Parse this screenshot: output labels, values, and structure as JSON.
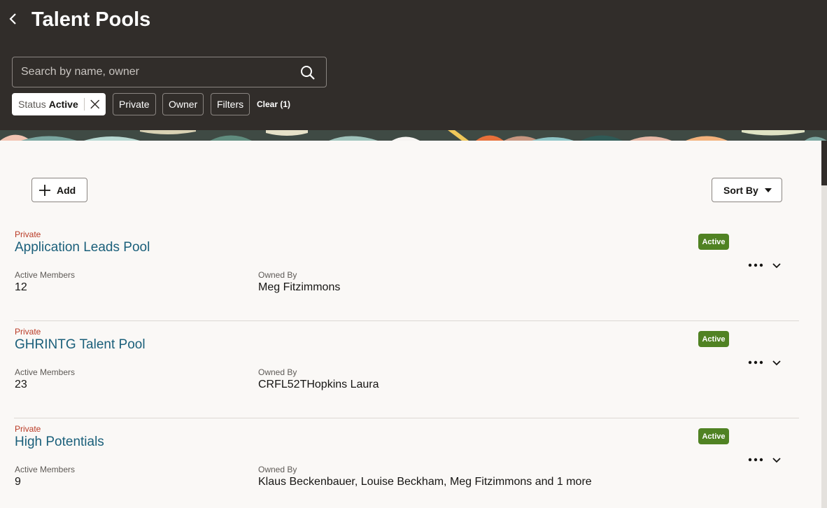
{
  "header": {
    "title": "Talent Pools",
    "search_placeholder": "Search by name, owner",
    "filters": {
      "status_label": "Status",
      "status_value": "Active",
      "private_label": "Private",
      "owner_label": "Owner",
      "filters_label": "Filters",
      "clear_label": "Clear (1)"
    }
  },
  "toolbar": {
    "add_label": "Add",
    "sort_label": "Sort By"
  },
  "pools": [
    {
      "visibility": "Private",
      "name": "Application Leads Pool",
      "status": "Active",
      "members_label": "Active Members",
      "members_value": "12",
      "owner_label": "Owned By",
      "owner_value": "Meg Fitzimmons"
    },
    {
      "visibility": "Private",
      "name": "GHRINTG Talent Pool",
      "status": "Active",
      "members_label": "Active Members",
      "members_value": "23",
      "owner_label": "Owned By",
      "owner_value": "CRFL52THopkins Laura"
    },
    {
      "visibility": "Private",
      "name": "High Potentials",
      "status": "Active",
      "members_label": "Active Members",
      "members_value": "9",
      "owner_label": "Owned By",
      "owner_value": "Klaus Beckenbauer, Louise Beckham, Meg Fitzimmons and 1 more"
    }
  ],
  "colors": {
    "header_bg": "#312d2a",
    "link": "#1a5f7a",
    "private_text": "#b93a25",
    "active_badge": "#508223"
  },
  "icons": [
    "back-arrow-icon",
    "search-icon",
    "close-icon",
    "plus-icon",
    "caret-down-icon",
    "more-actions-icon",
    "chevron-down-icon"
  ]
}
